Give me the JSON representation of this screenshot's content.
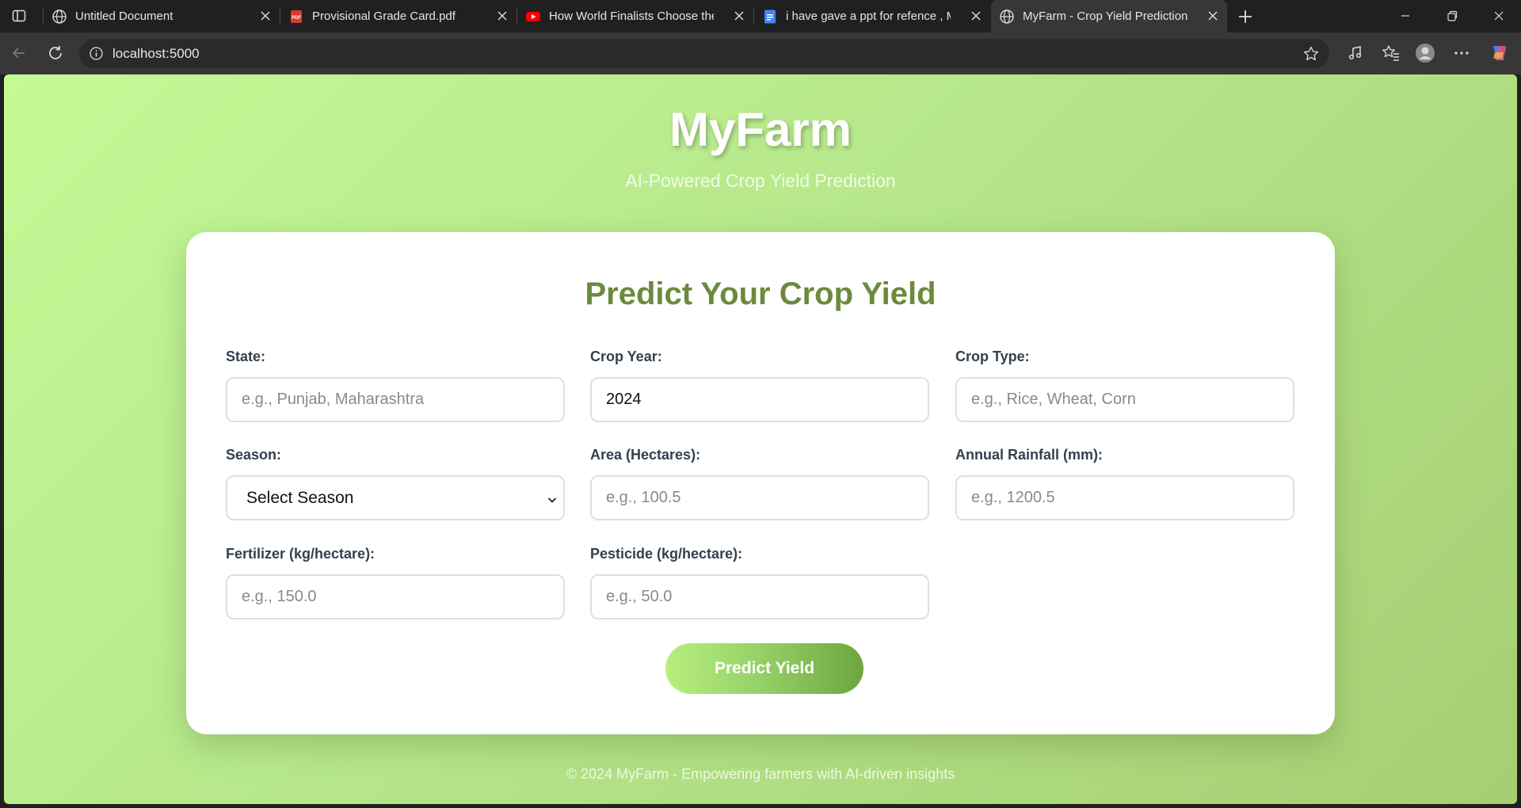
{
  "browser": {
    "tabs": [
      {
        "title": "Untitled Document",
        "icon": "globe-icon"
      },
      {
        "title": "Provisional Grade Card.pdf",
        "icon": "pdf-icon"
      },
      {
        "title": "How World Finalists Choose their",
        "icon": "youtube-icon"
      },
      {
        "title": "i have gave a ppt for refence , My",
        "icon": "docs-icon"
      },
      {
        "title": "MyFarm - Crop Yield Prediction",
        "icon": "globe-icon",
        "active": true
      }
    ],
    "url": "localhost:5000"
  },
  "header": {
    "brand": "MyFarm",
    "tagline": "AI-Powered Crop Yield Prediction"
  },
  "form": {
    "title": "Predict Your Crop Yield",
    "fields": {
      "state": {
        "label": "State:",
        "placeholder": "e.g., Punjab, Maharashtra",
        "value": ""
      },
      "crop_year": {
        "label": "Crop Year:",
        "placeholder": "",
        "value": "2024"
      },
      "crop_type": {
        "label": "Crop Type:",
        "placeholder": "e.g., Rice, Wheat, Corn",
        "value": ""
      },
      "season": {
        "label": "Season:",
        "selected": "Select Season"
      },
      "area": {
        "label": "Area (Hectares):",
        "placeholder": "e.g., 100.5",
        "value": ""
      },
      "rainfall": {
        "label": "Annual Rainfall (mm):",
        "placeholder": "e.g., 1200.5",
        "value": ""
      },
      "fertilizer": {
        "label": "Fertilizer (kg/hectare):",
        "placeholder": "e.g., 150.0",
        "value": ""
      },
      "pesticide": {
        "label": "Pesticide (kg/hectare):",
        "placeholder": "e.g., 50.0",
        "value": ""
      }
    },
    "submit_label": "Predict Yield"
  },
  "footer": {
    "text": "© 2024 MyFarm - Empowering farmers with AI-driven insights"
  },
  "colors": {
    "accent_green": "#6c8a3d",
    "background_light": "#c3fa95",
    "background_dark": "#a6ce73"
  }
}
